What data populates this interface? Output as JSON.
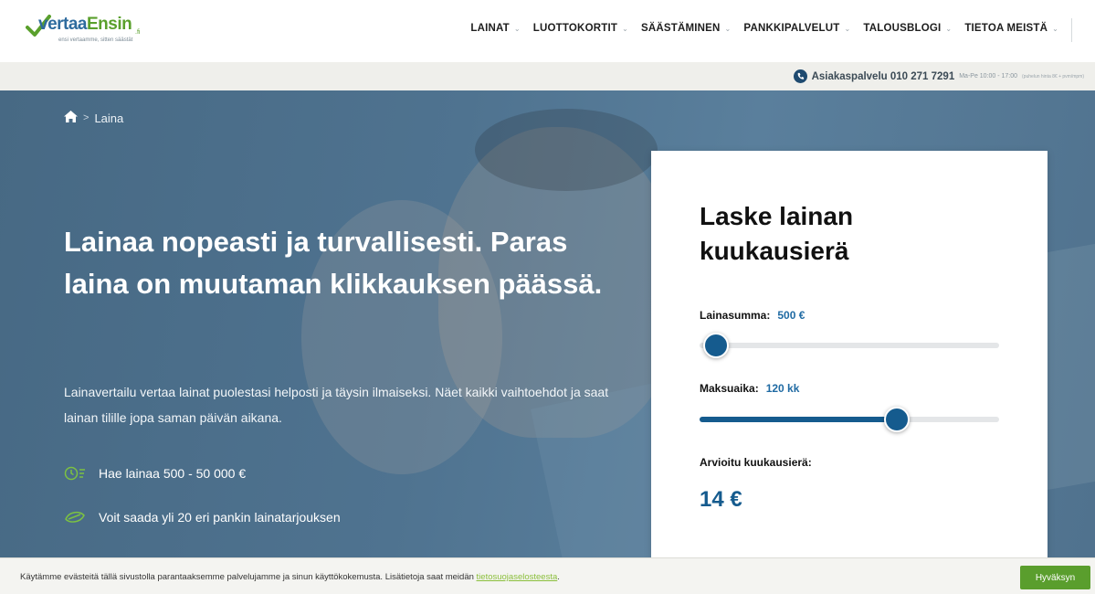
{
  "brand": {
    "logo_text_main": "vertaa",
    "logo_text_accent": "Ensin",
    "logo_tld": ".fi",
    "logo_tagline": "ensi vertaamme, sitten säästät",
    "colors": {
      "primary": "#155b8e",
      "green": "#5aa02c",
      "hero_overlay": "#4f7390"
    }
  },
  "nav": {
    "items": [
      {
        "label": "LAINAT",
        "icon": "chevron-down-icon"
      },
      {
        "label": "LUOTTOKORTIT",
        "icon": "chevron-down-icon"
      },
      {
        "label": "SÄÄSTÄMINEN",
        "icon": "chevron-down-icon"
      },
      {
        "label": "PANKKIPALVELUT",
        "icon": "chevron-down-icon"
      },
      {
        "label": "TALOUSBLOGI",
        "icon": "chevron-down-icon"
      },
      {
        "label": "TIETOA MEISTÄ",
        "icon": "chevron-down-icon"
      }
    ],
    "chevron": "⌄"
  },
  "service": {
    "icon": "phone-icon",
    "label": "Asiakaspalvelu 010 271 7291",
    "hours": "Ma-Pe 10:00 - 17:00",
    "fee": "(puhelun hinta 8€ + pvm/mpm)"
  },
  "breadcrumb": {
    "home_icon": "home-icon",
    "separator": ">",
    "current": "Laina"
  },
  "hero": {
    "title": "Lainaa nopeasti ja turvallisesti. Paras laina on muutaman klikkauksen päässä.",
    "description": "Lainavertailu vertaa lainat puolestasi helposti ja täysin ilmaiseksi. Näet kaikki vaihtoehdot ja saat lainan tilille jopa saman päivän aikana.",
    "features": [
      {
        "icon": "clock-icon",
        "text": "Hae lainaa 500 - 50 000 €"
      },
      {
        "icon": "leaf-icon",
        "text": "Voit saada yli 20 eri pankin lainatarjouksen"
      }
    ]
  },
  "calculator": {
    "title": "Laske lainan kuukausierä",
    "amount_label": "Lainasumma:",
    "amount_value": "500 €",
    "amount_fraction": 0.0,
    "term_label": "Maksuaika:",
    "term_value": "120 kk",
    "term_fraction": 0.64,
    "result_label": "Arvioitu kuukausierä:",
    "result_value": "14 €"
  },
  "cookie": {
    "text": "Käytämme evästeitä tällä sivustolla parantaaksemme palvelujamme ja sinun käyttökokemusta. Lisätietoja saat meidän ",
    "link_text": "tietosuojaselosteesta",
    "text_end": ".",
    "accept_label": "Hyväksyn"
  }
}
